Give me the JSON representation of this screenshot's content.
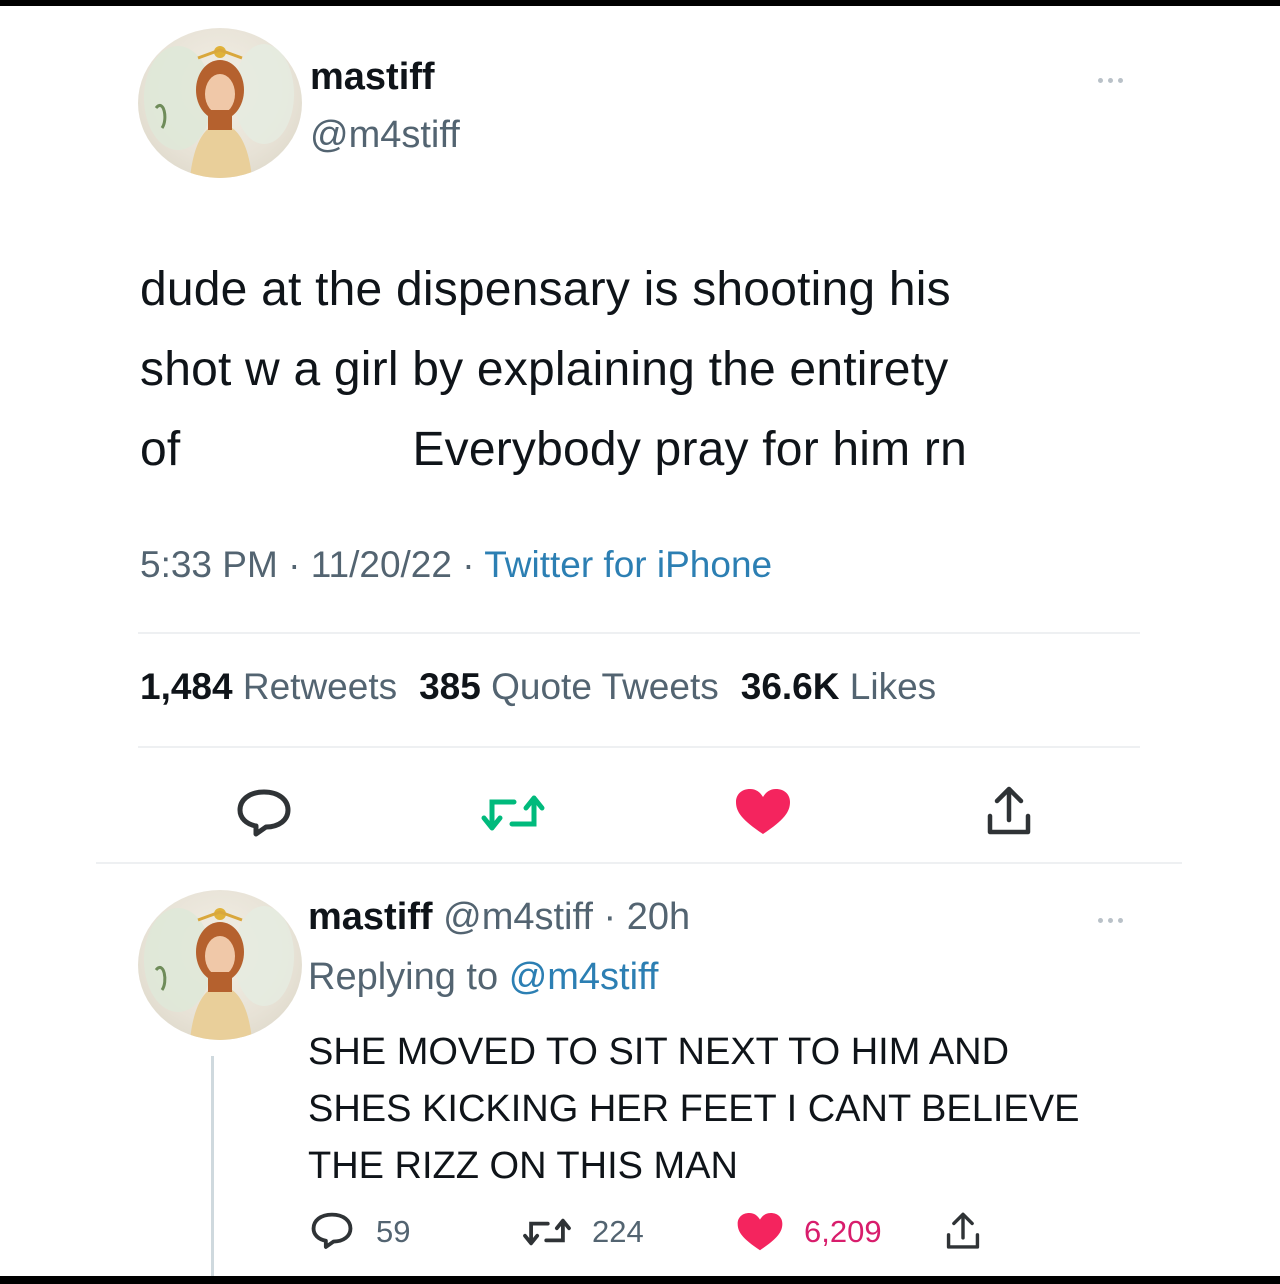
{
  "tweet": {
    "author_name": "mastiff",
    "author_handle": "@m4stiff",
    "text_line1": "dude at the dispensary is shooting his",
    "text_line2": "shot w a girl by explaining the entirety",
    "text_line3a": "of",
    "text_line3b": "Everybody pray for him rn",
    "time": "5:33 PM",
    "date": "11/20/22",
    "source": "Twitter for iPhone",
    "retweets_count": "1,484",
    "retweets_label": "Retweets",
    "quotes_count": "385",
    "quotes_label": "Quote Tweets",
    "likes_count": "36.6K",
    "likes_label": "Likes"
  },
  "reply": {
    "author_name": "mastiff",
    "author_handle": "@m4stiff",
    "time_ago": "20h",
    "replying_prefix": "Replying to",
    "replying_handle": "@m4stiff",
    "text_line1": "SHE MOVED TO SIT NEXT TO HIM AND",
    "text_line2": "SHES KICKING HER FEET I CANT BELIEVE",
    "text_line3": "THE RIZZ ON THIS MAN",
    "reply_count": "59",
    "retweet_count": "224",
    "like_count": "6,209"
  },
  "icons": {
    "reply": "reply-icon",
    "retweet": "retweet-icon",
    "like": "heart-icon",
    "share": "share-icon",
    "more": "more-icon"
  },
  "colors": {
    "heart": "#f4245e",
    "retweet": "#00ba7c",
    "link": "#2c7fb3",
    "muted": "#536471"
  }
}
